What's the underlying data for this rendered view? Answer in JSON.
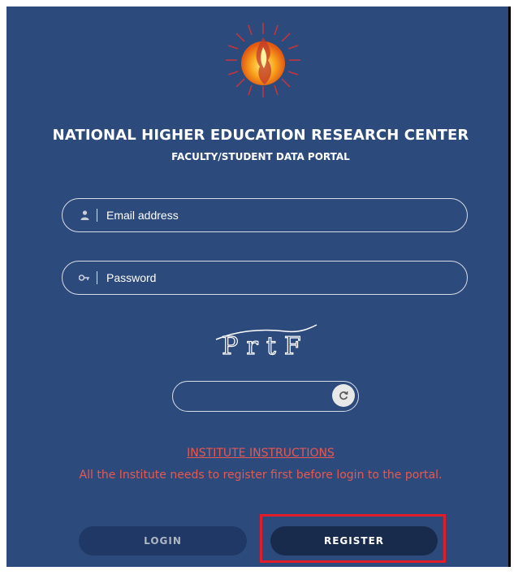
{
  "header": {
    "title": "NATIONAL HIGHER EDUCATION RESEARCH CENTER",
    "subtitle": "FACULTY/STUDENT DATA PORTAL"
  },
  "form": {
    "email_placeholder": "Email address",
    "password_placeholder": "Password",
    "captcha_text": "PrtF",
    "captcha_value": ""
  },
  "instructions": {
    "title": "INSTITUTE INSTRUCTIONS",
    "text": "All the Institute needs to register first before login to the portal."
  },
  "buttons": {
    "login_label": "LOGIN",
    "register_label": "REGISTER"
  },
  "colors": {
    "panel_bg": "#2d4a7c",
    "instruction_text": "#e8584f",
    "highlight_box": "#e21d2a"
  },
  "icons": {
    "email": "user-icon",
    "password": "key-icon",
    "refresh": "refresh-icon",
    "logo": "flame-logo"
  }
}
